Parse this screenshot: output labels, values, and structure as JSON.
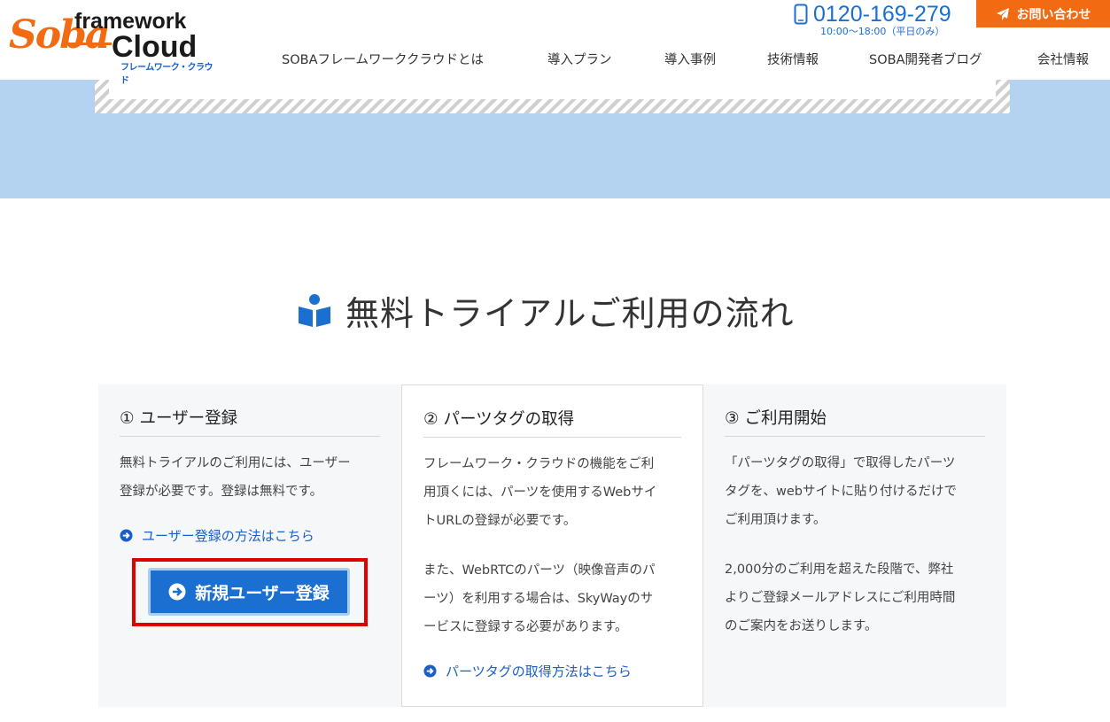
{
  "header": {
    "logo": {
      "soba": "Soba",
      "framework": "framework",
      "cloud": "Cloud",
      "kana": "フレームワーク・クラウド"
    },
    "phone": {
      "number": "0120-169-279",
      "hours": "10:00〜18:00（平日のみ）"
    },
    "contact_label": "お問い合わせ",
    "nav": [
      "SOBAフレームワーククラウドとは",
      "導入プラン",
      "導入事例",
      "技術情報",
      "SOBA開発者ブログ",
      "会社情報"
    ]
  },
  "section": {
    "title": "無料トライアルご利用の流れ"
  },
  "steps": [
    {
      "title": "① ユーザー登録",
      "lines": [
        "無料トライアルのご利用には、ユーザー",
        "登録が必要です。登録は無料です。"
      ],
      "link": "ユーザー登録の方法はこちら",
      "button": "新規ユーザー登録"
    },
    {
      "title": "② パーツタグの取得",
      "lines": [
        "フレームワーク・クラウドの機能をご利",
        "用頂くには、パーツを使用するWebサイ",
        "トURLの登録が必要です。"
      ],
      "lines2": [
        "また、WebRTCのパーツ（映像音声のパ",
        "ーツ）を利用する場合は、SkyWayのサ",
        "ービスに登録する必要があります。"
      ],
      "link": "パーツタグの取得方法はこちら"
    },
    {
      "title": "③ ご利用開始",
      "lines": [
        "「パーツタグの取得」で取得したパーツ",
        "タグを、webサイトに貼り付けるだけで",
        "ご利用頂けます。"
      ],
      "lines2": [
        "2,000分のご利用を超えた段階で、弊社",
        "よりご登録メールアドレスにご利用時間",
        "のご案内をお送りします。"
      ]
    }
  ],
  "colors": {
    "accent_blue": "#1a6fd1",
    "brand_orange": "#f26a12",
    "band_blue": "#b3d3f0",
    "highlight_red": "#e00000"
  }
}
